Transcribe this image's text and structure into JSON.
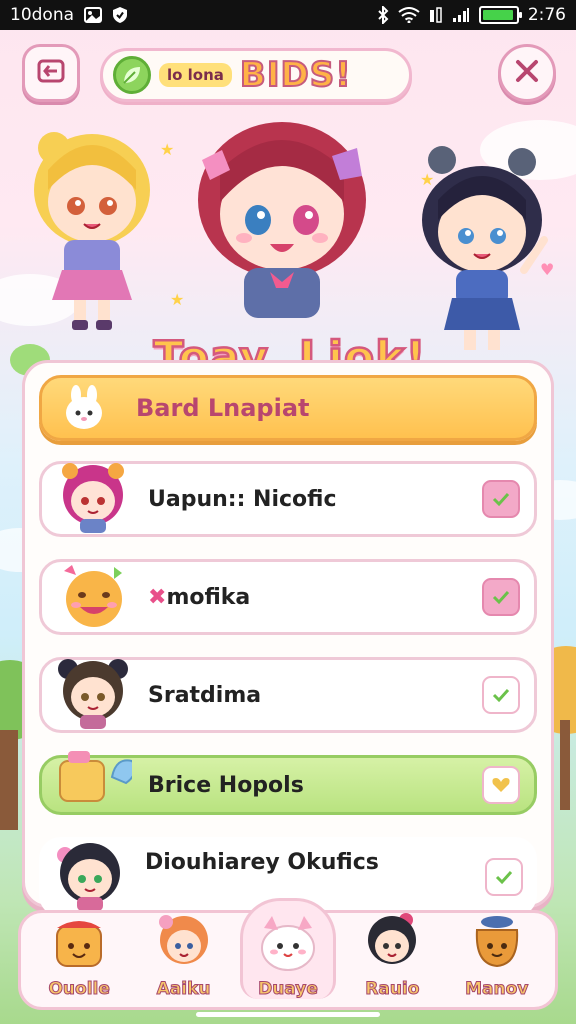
{
  "status_bar": {
    "left_text": "10dona",
    "time": "2:76",
    "battery_level": 0.95
  },
  "header": {
    "title_small": "lo lona",
    "title_big": "BIDS!",
    "left_button_icon": "back-icon",
    "right_button_icon": "close-icon"
  },
  "hero": {
    "title": "Toay. Liok!"
  },
  "list": {
    "header_label": "Bard Lnapiat",
    "items": [
      {
        "label": "Uapun:: Nicofic",
        "checked": true
      },
      {
        "label": "mofika",
        "checked": true
      },
      {
        "label": "Sratdima",
        "checked": false
      },
      {
        "label": "Brice Hopols",
        "checked": false
      },
      {
        "label": "Diouhiarey Okufics",
        "checked": false
      }
    ]
  },
  "bottom_nav": {
    "items": [
      {
        "label": "Ouolle"
      },
      {
        "label": "Aaiku"
      },
      {
        "label": "Duaye"
      },
      {
        "label": "Rauio"
      },
      {
        "label": "Manov"
      }
    ],
    "active_index": 2
  },
  "colors": {
    "accent_pink": "#e39ab9",
    "accent_yellow": "#ffc14f",
    "accent_green": "#b9e380"
  }
}
